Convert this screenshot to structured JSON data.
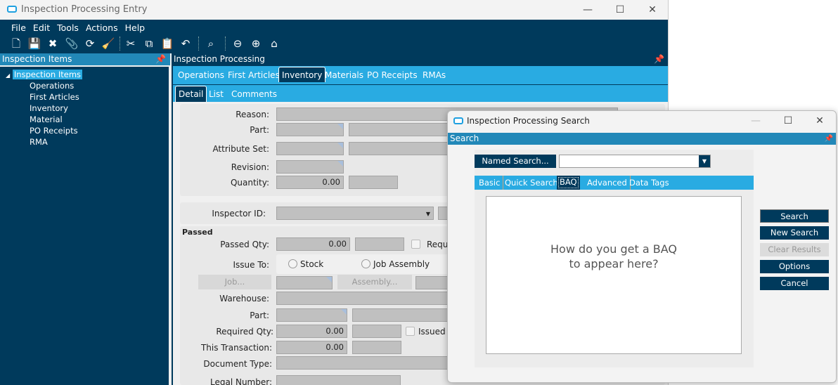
{
  "main_window": {
    "title": "Inspection Processing Entry",
    "controls": [
      "—",
      "☐",
      "✕"
    ]
  },
  "menu": [
    "File",
    "Edit",
    "Tools",
    "Actions",
    "Help"
  ],
  "toolbar_icons": [
    "new-icon",
    "save-icon",
    "delete-icon",
    "attach-icon",
    "refresh-icon",
    "clear-icon",
    "cut-icon",
    "copy-icon",
    "paste-icon",
    "undo-icon",
    "search-binoculars-icon",
    "back-icon",
    "forward-icon",
    "home-icon"
  ],
  "left_panel": {
    "title": "Inspection Items",
    "root": "Inspection Items",
    "items": [
      "Operations",
      "First Articles",
      "Inventory",
      "Material",
      "PO Receipts",
      "RMA"
    ]
  },
  "right_panel": {
    "title": "Inspection Processing",
    "tabs": [
      "Operations",
      "First Articles",
      "Inventory",
      "Materials",
      "PO Receipts",
      "RMAs"
    ],
    "active_tab": "Inventory",
    "subtabs": [
      "Detail",
      "List",
      "Comments"
    ],
    "active_subtab": "Detail"
  },
  "form": {
    "reason": "Reason:",
    "part": "Part:",
    "attribute_set": "Attribute Set:",
    "revision": "Revision:",
    "quantity": "Quantity:",
    "quantity_value": "0.00",
    "inspector_id": "Inspector ID:",
    "passed_section": "Passed",
    "passed_qty": "Passed Qty:",
    "passed_qty_value": "0.00",
    "requ": "Requ",
    "issue_to": "Issue To:",
    "stock": "Stock",
    "job_assembly": "Job Assembly",
    "job_button": "Job...",
    "assembly_button": "Assembly...",
    "warehouse": "Warehouse:",
    "part2": "Part:",
    "required_qty": "Required Qty:",
    "required_qty_value": "0.00",
    "issued": "Issued",
    "this_transaction": "This Transaction:",
    "this_transaction_value": "0.00",
    "document_type": "Document Type:",
    "legal_number": "Legal Number:"
  },
  "search_dialog": {
    "title": "Inspection Processing Search",
    "header": "Search",
    "named_search": "Named Search...",
    "named_search_value": "",
    "tabs": [
      "Basic",
      "Quick Search",
      "BAQ",
      "Advanced",
      "Data Tags"
    ],
    "active_tab": "BAQ",
    "message_line1": "How do you get a BAQ",
    "message_line2": "to appear here?",
    "buttons": {
      "search": "Search",
      "new_search": "New Search",
      "clear_results": "Clear Results",
      "options": "Options",
      "cancel": "Cancel"
    }
  },
  "colors": {
    "navy": "#003a5c",
    "header_blue": "#2288b8",
    "tab_blue": "#29abe2"
  }
}
